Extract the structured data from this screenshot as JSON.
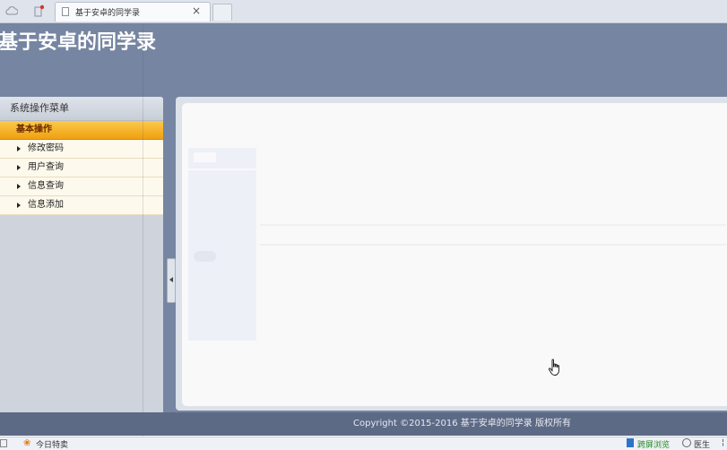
{
  "browser": {
    "tab_title": "基于安卓的同学录",
    "tab_close": "×",
    "toolbar_icons": [
      "cloud-icon",
      "bookmark-icon"
    ]
  },
  "app": {
    "title": "基于安卓的同学录"
  },
  "sidebar": {
    "header": "系统操作菜单",
    "group_label": "基本操作",
    "items": [
      {
        "label": "修改密码"
      },
      {
        "label": "用户查询"
      },
      {
        "label": "信息查询"
      },
      {
        "label": "信息添加"
      }
    ]
  },
  "footer": {
    "copyright": "Copyright ©2015-2016 基于安卓的同学录 版权所有"
  },
  "statusbar": {
    "news": "今日特卖",
    "screen": "跨屏浏览",
    "doc": "医生",
    "edge": "¦"
  },
  "colors": {
    "header_bg": "#7685a1",
    "footer_bg": "#5d6a86",
    "menu_group": "#f0a010",
    "sidebar_bg": "#cfd4dc"
  }
}
